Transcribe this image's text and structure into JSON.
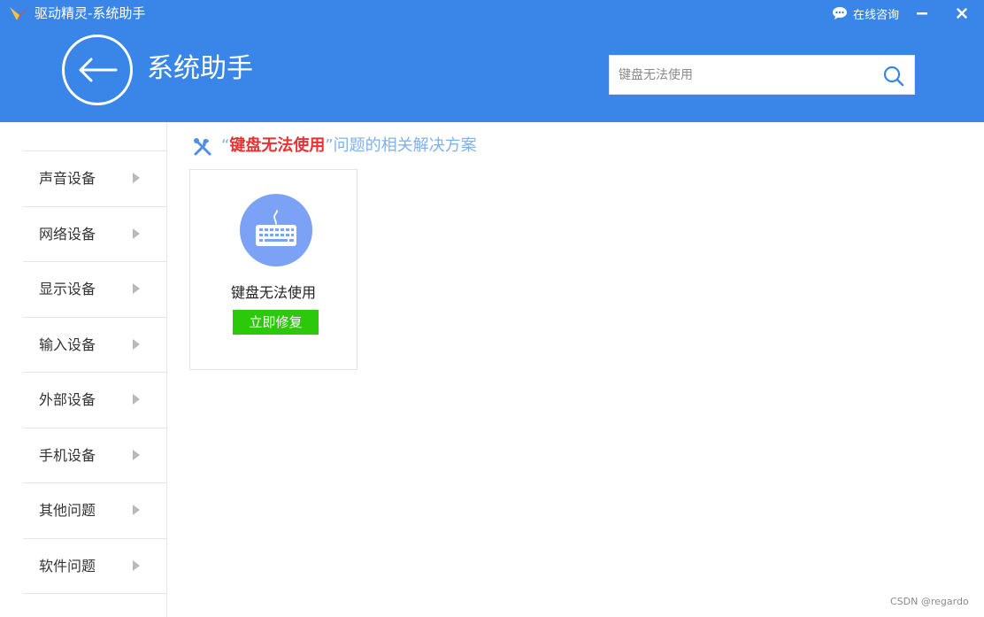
{
  "window": {
    "title": "驱动精灵-系统助手",
    "consult_label": "在线咨询",
    "minimize_symbol": "—",
    "close_symbol": "✕"
  },
  "header": {
    "title": "系统助手",
    "search": {
      "value": "",
      "placeholder": "键盘无法使用"
    }
  },
  "sidebar": {
    "items": [
      {
        "label": "声音设备"
      },
      {
        "label": "网络设备"
      },
      {
        "label": "显示设备"
      },
      {
        "label": "输入设备"
      },
      {
        "label": "外部设备"
      },
      {
        "label": "手机设备"
      },
      {
        "label": "其他问题"
      },
      {
        "label": "软件问题"
      }
    ]
  },
  "main": {
    "title_quote_open": "“",
    "title_keyword": "键盘无法使用",
    "title_quote_close": "”",
    "title_suffix": "问题的相关解决方案",
    "cards": [
      {
        "label": "键盘无法使用",
        "button_label": "立即修复",
        "icon": "keyboard-icon"
      }
    ]
  },
  "watermark": "CSDN @regardo",
  "colors": {
    "header_blue": "#3a86e8",
    "accent_blue": "#7fb0f0",
    "keyword_red": "#e53333",
    "fix_green": "#2bc90a",
    "icon_circle": "#7ba2f5"
  }
}
